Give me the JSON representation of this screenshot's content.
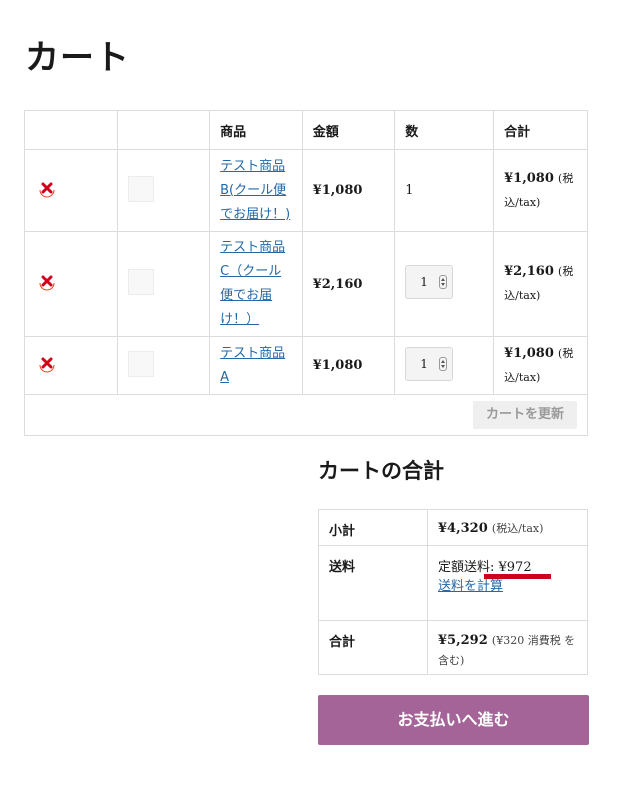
{
  "page": {
    "title": "カート"
  },
  "cart": {
    "headers": [
      "",
      "",
      "商品",
      "金額",
      "数",
      "合計"
    ],
    "items": [
      {
        "name": "テスト商品B(クール便でお届け！)",
        "price": "¥1,080",
        "qty": "1",
        "subtotal": "¥1,080",
        "tax_note": "(税込/tax)"
      },
      {
        "name": "テスト商品C（クール便でお届け！）",
        "price": "¥2,160",
        "qty": "1",
        "subtotal": "¥2,160",
        "tax_note": "(税込/tax)"
      },
      {
        "name": "テスト商品A",
        "price": "¥1,080",
        "qty": "1",
        "subtotal": "¥1,080",
        "tax_note": "(税込/tax)"
      }
    ],
    "update_label": "カートを更新"
  },
  "totals": {
    "title": "カートの合計",
    "subtotal_label": "小計",
    "subtotal_value": "¥4,320",
    "subtotal_note": "(税込/tax)",
    "shipping_label": "送料",
    "shipping_value": "定額送料: ¥972",
    "shipping_calc": "送料を計算",
    "total_label": "合計",
    "total_value": "¥5,292",
    "total_note": "(¥320 消費税 を含む)"
  },
  "checkout": {
    "label": "お支払いへ進む"
  },
  "colors": {
    "accent": "#a46497",
    "link": "#2468a8",
    "remove": "#e2401c",
    "highlight": "#d0021b"
  }
}
